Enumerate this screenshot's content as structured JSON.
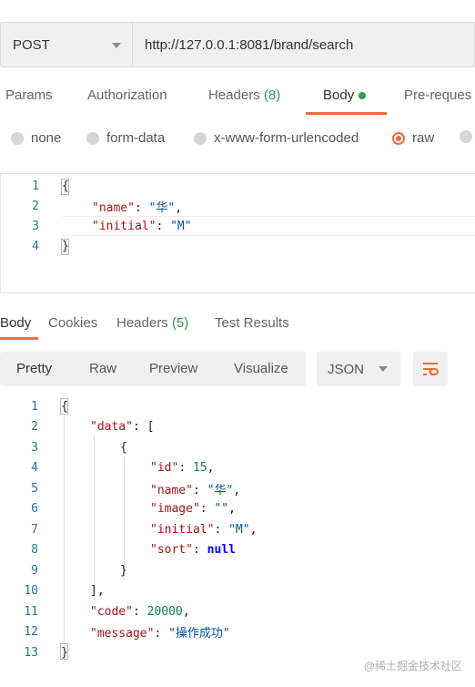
{
  "request": {
    "method": "POST",
    "url": "http://127.0.0.1:8081/brand/search"
  },
  "request_tabs": {
    "params": "Params",
    "authorization": "Authorization",
    "headers": "Headers",
    "headers_count": "(8)",
    "body": "Body",
    "prerequest": "Pre-reques"
  },
  "body_types": {
    "none": "none",
    "form_data": "form-data",
    "urlencoded": "x-www-form-urlencoded",
    "raw": "raw",
    "selected": "raw"
  },
  "request_body": {
    "line_numbers": [
      "1",
      "2",
      "3",
      "4"
    ],
    "l1": "{",
    "k_name": "\"name\"",
    "v_name": "\"华\"",
    "k_initial": "\"initial\"",
    "v_initial": "\"M\"",
    "l4": "}"
  },
  "response_tabs": {
    "body": "Body",
    "cookies": "Cookies",
    "headers": "Headers",
    "headers_count": "(5)",
    "test_results": "Test Results"
  },
  "view_modes": {
    "pretty": "Pretty",
    "raw": "Raw",
    "preview": "Preview",
    "visualize": "Visualize",
    "format": "JSON"
  },
  "response_body": {
    "line_numbers": [
      "1",
      "2",
      "3",
      "4",
      "5",
      "6",
      "7",
      "8",
      "9",
      "10",
      "11",
      "12",
      "13"
    ],
    "open": "{",
    "k_data": "\"data\"",
    "open_arr": "[",
    "open_obj": "{",
    "k_id": "\"id\"",
    "v_id": "15",
    "k_name": "\"name\"",
    "v_name": "\"华\"",
    "k_image": "\"image\"",
    "v_image": "\"\"",
    "k_initial": "\"initial\"",
    "v_initial": "\"M\"",
    "k_sort": "\"sort\"",
    "v_sort": "null",
    "close_obj": "}",
    "close_arr": "],",
    "k_code": "\"code\"",
    "v_code": "20000",
    "k_message": "\"message\"",
    "v_message": "\"操作成功\"",
    "close": "}"
  },
  "watermark": "@稀土掘金技术社区",
  "colors": {
    "accent": "#f26b3a",
    "count_green": "#2e9d4c",
    "line_number": "#237893",
    "json_key": "#a31515",
    "json_string": "#0451a5",
    "json_number": "#098658"
  },
  "icons": {
    "method_dropdown": "chevron-down-icon",
    "format_dropdown": "chevron-down-icon",
    "wrap": "wrap-lines-icon"
  }
}
